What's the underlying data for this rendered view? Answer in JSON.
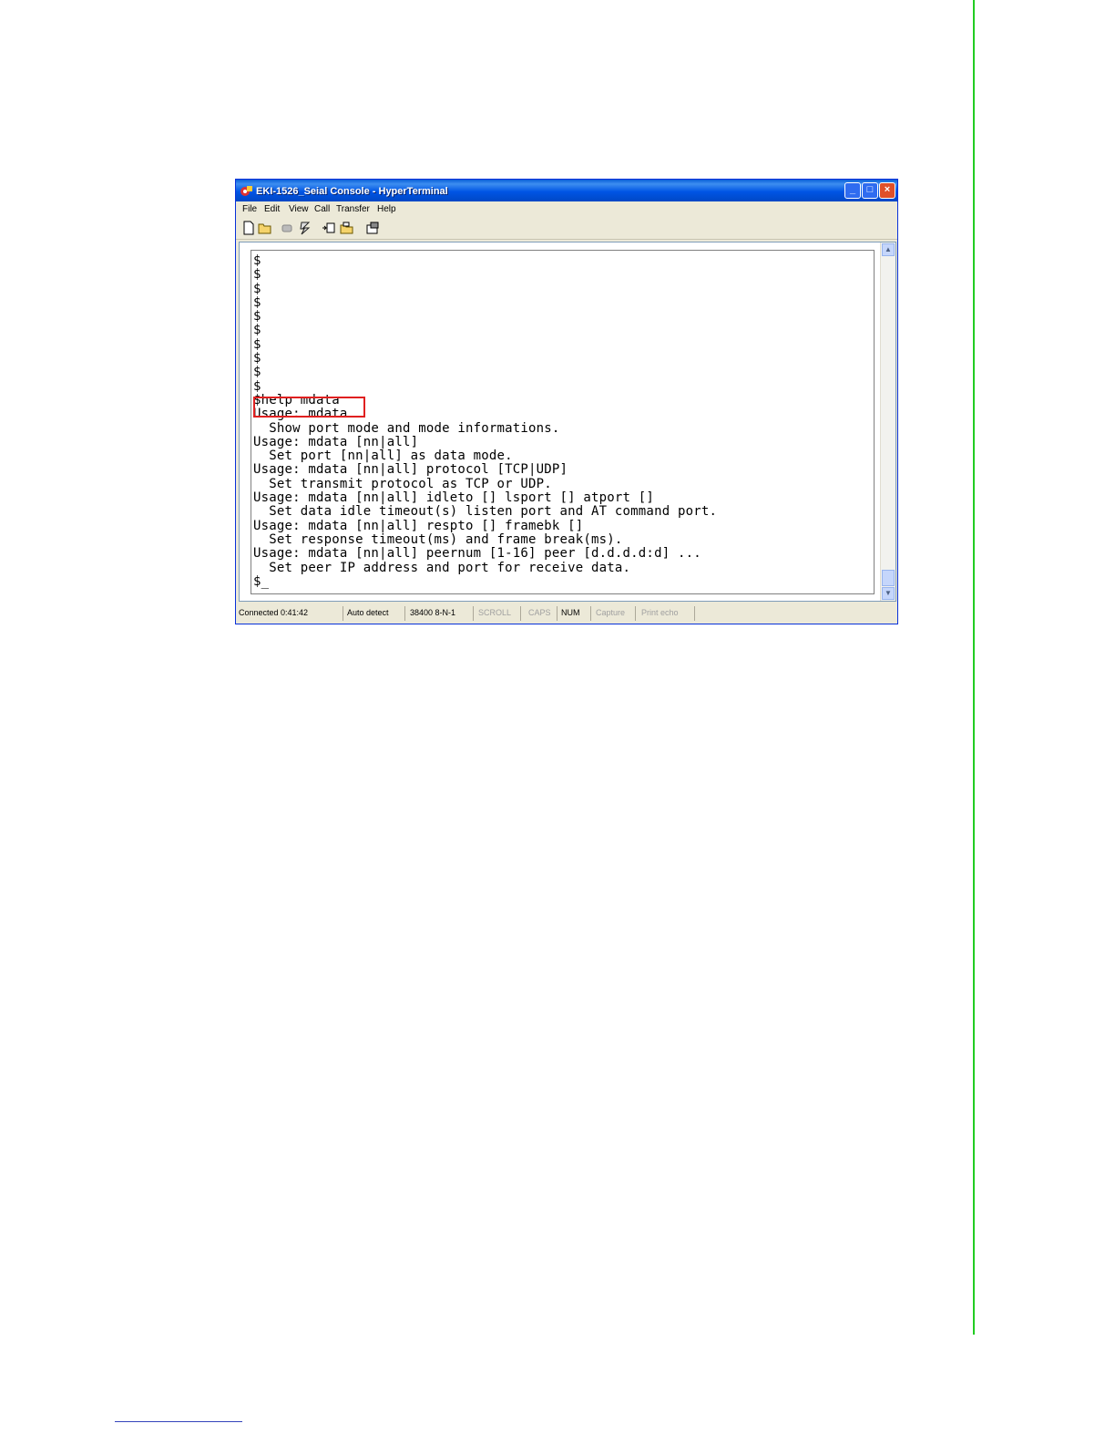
{
  "window": {
    "title": "EKI-1526_Seial Console - HyperTerminal",
    "controls": [
      "_",
      "□",
      "×"
    ]
  },
  "menu": [
    "File",
    "Edit",
    "View",
    "Call",
    "Transfer",
    "Help"
  ],
  "toolbar_icons": [
    "new-icon",
    "open-icon",
    "disconnect-icon",
    "dial-icon",
    "send-icon",
    "receive-icon",
    "properties-icon"
  ],
  "terminal": {
    "lines": [
      "$",
      "$",
      "$",
      "$",
      "$",
      "$",
      "$",
      "$",
      "$",
      "$",
      "$help mdata",
      "Usage: mdata",
      "  Show port mode and mode informations.",
      "Usage: mdata [nn|all]",
      "  Set port [nn|all] as data mode.",
      "Usage: mdata [nn|all] protocol [TCP|UDP]",
      "  Set transmit protocol as TCP or UDP.",
      "Usage: mdata [nn|all] idleto [] lsport [] atport []",
      "  Set data idle timeout(s) listen port and AT command port.",
      "Usage: mdata [nn|all] respto [] framebk []",
      "  Set response timeout(ms) and frame break(ms).",
      "Usage: mdata [nn|all] peernum [1-16] peer [d.d.d.d:d] ...",
      "  Set peer IP address and port for receive data.",
      "$_"
    ],
    "highlighted_command": "$help mdata"
  },
  "statusbar": {
    "connected": "Connected 0:41:42",
    "detect": "Auto detect",
    "settings": "38400 8-N-1",
    "scroll": "SCROLL",
    "caps": "CAPS",
    "num": "NUM",
    "capture": "Capture",
    "print_echo": "Print echo"
  },
  "colors": {
    "highlight": "#e02020",
    "page_rule": "#22cc22"
  }
}
